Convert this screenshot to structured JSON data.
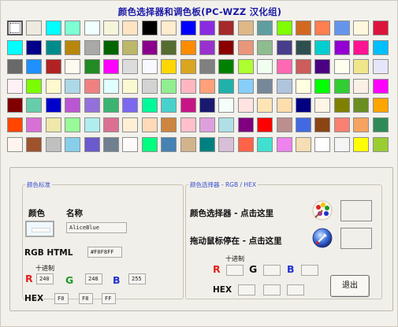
{
  "window": {
    "title": "颜色选择器和调色板(PC-WZZ 汉化组)"
  },
  "colors": {
    "red_label": "#e02020",
    "green_label": "#1a9a2a",
    "blue_label": "#2030d0",
    "title_blue": "#1a1aa6",
    "group_legend": "#3a4fd0"
  },
  "palette": {
    "columns": 20,
    "selected_index": 0,
    "swatches": [
      "#ffffff",
      "#eeeae0",
      "#00ffff",
      "#7fffd4",
      "#f0ffff",
      "#f5f5dc",
      "#ffe4c4",
      "#000000",
      "#ffebcd",
      "#0000ff",
      "#8a2be2",
      "#a52a2a",
      "#deb887",
      "#5f9ea0",
      "#7fff00",
      "#d2691e",
      "#ff7f50",
      "#6495ed",
      "#fff8dc",
      "#dc143c",
      "#00ffff",
      "#00008b",
      "#008b8b",
      "#b8860b",
      "#a9a9a9",
      "#006400",
      "#bdb76b",
      "#8b008b",
      "#556b2f",
      "#ff8c00",
      "#9932cc",
      "#8b0000",
      "#e9967a",
      "#8fbc8f",
      "#483d8b",
      "#2f4f4f",
      "#00ced1",
      "#9400d3",
      "#ff1493",
      "#00bfff",
      "#696969",
      "#1e90ff",
      "#b22222",
      "#fffaf0",
      "#228b22",
      "#ff00ff",
      "#dcdcdc",
      "#f8f8ff",
      "#ffd700",
      "#daa520",
      "#808080",
      "#008000",
      "#adff2f",
      "#f0fff0",
      "#ff69b4",
      "#cd5c5c",
      "#4b0082",
      "#fffff0",
      "#f0e68c",
      "#e6e6fa",
      "#fff0f5",
      "#7cfc00",
      "#fffacd",
      "#add8e6",
      "#f08080",
      "#e0ffff",
      "#fafad2",
      "#d3d3d3",
      "#90ee90",
      "#ffb6c1",
      "#ffa07a",
      "#20b2aa",
      "#87cefa",
      "#778899",
      "#b0c4de",
      "#ffffe0",
      "#00ff00",
      "#32cd32",
      "#faf0e6",
      "#ff00ff",
      "#800000",
      "#66cdaa",
      "#0000cd",
      "#ba55d3",
      "#9370db",
      "#3cb371",
      "#7b68ee",
      "#00fa9a",
      "#48d1cc",
      "#c71585",
      "#191970",
      "#f5fffa",
      "#ffe4e1",
      "#ffe4b5",
      "#ffdead",
      "#000080",
      "#fdf5e6",
      "#808000",
      "#6b8e23",
      "#ffa500",
      "#ff4500",
      "#da70d6",
      "#eee8aa",
      "#98fb98",
      "#afeeee",
      "#db7093",
      "#ffefd5",
      "#ffdab9",
      "#cd853f",
      "#ffc0cb",
      "#dda0dd",
      "#b0e0e6",
      "#800080",
      "#ff0000",
      "#bc8f8f",
      "#4169e1",
      "#8b4513",
      "#fa8072",
      "#f4a460",
      "#2e8b57",
      "#fff5ee",
      "#a0522d",
      "#c0c0c0",
      "#87ceeb",
      "#6a5acd",
      "#708090",
      "#fffafa",
      "#00ff7f",
      "#4682b4",
      "#d2b48c",
      "#008080",
      "#d8bfd8",
      "#ff6347",
      "#40e0d0",
      "#ee82ee",
      "#f5deb3",
      "#ffffff",
      "#f5f5f5",
      "#ffff00",
      "#9acd32"
    ]
  },
  "color_standard": {
    "legend": "颜色标准",
    "color_label": "颜色",
    "name_label": "名称",
    "name_value": "AliceBlue",
    "preview_color": "#f0f8ff",
    "rgb_html_label": "RGB HTML",
    "rgb_html_value": "#F0F8FF",
    "decimal_label": "十进制",
    "r_label": "R",
    "g_label": "G",
    "b_label": "B",
    "r_value": "240",
    "g_value": "248",
    "b_value": "255",
    "hex_label": "HEX",
    "hex_r": "F0",
    "hex_g": "F8",
    "hex_b": "FF"
  },
  "color_picker": {
    "legend": "颜色选择器 - RGB / HEX",
    "pick_label": "颜色选择器 - 点击这里",
    "hover_label": "拖动鼠标停在 - 点击这里",
    "decimal_label": "十进制",
    "r_label": "R",
    "g_label": "G",
    "b_label": "B",
    "r_value": "",
    "g_value": "",
    "b_value": "",
    "hex_label": "HEX",
    "hex_r": "",
    "hex_g": "",
    "hex_b": "",
    "exit_button": "退出",
    "palette_icon": "color-palette-icon",
    "picker_icon": "color-picker-icon"
  }
}
